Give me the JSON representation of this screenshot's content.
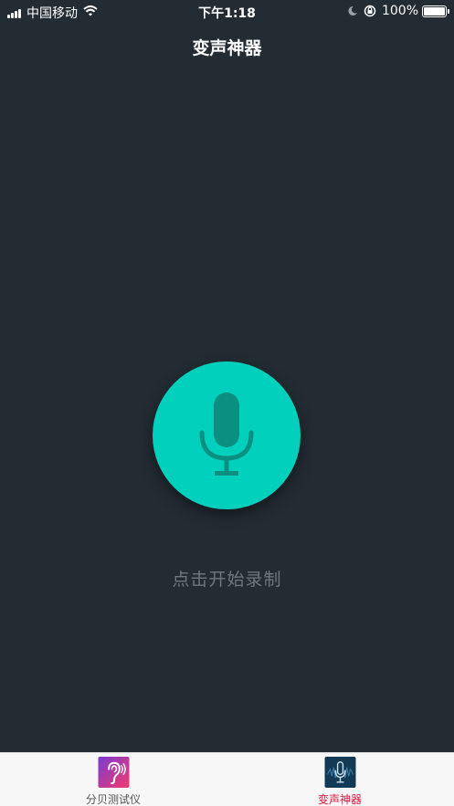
{
  "status_bar": {
    "carrier": "中国移动",
    "time": "下午1:18",
    "battery": "100%",
    "icons": [
      "signal-icon",
      "wifi-icon",
      "moon-icon",
      "orientation-lock-icon",
      "battery-icon"
    ]
  },
  "nav": {
    "title": "变声神器"
  },
  "main": {
    "record_hint": "点击开始录制",
    "mic_icon": "microphone-icon"
  },
  "tab_bar": {
    "tabs": [
      {
        "label": "分贝测试仪",
        "icon": "ear-icon",
        "selected": false
      },
      {
        "label": "变声神器",
        "icon": "microphone-icon",
        "selected": true
      }
    ]
  },
  "colors": {
    "background": "#232c33",
    "accent": "#00d0bc",
    "mic_glyph": "#0a8f80",
    "hint_text": "#6f787e",
    "tab_selected": "#e4143c",
    "tab_unselected": "#555555"
  }
}
